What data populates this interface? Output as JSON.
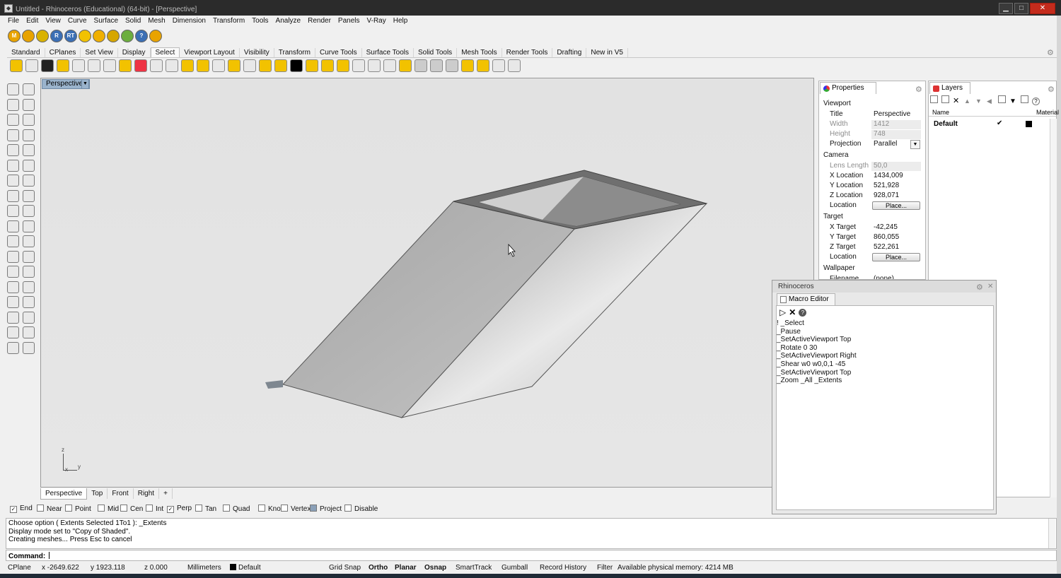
{
  "title_bar": {
    "title": "Untitled - Rhinoceros (Educational) (64-bit) - [Perspective]",
    "minimize": "▁",
    "maximize": "□",
    "close": "✕"
  },
  "menu": [
    "File",
    "Edit",
    "View",
    "Curve",
    "Surface",
    "Solid",
    "Mesh",
    "Dimension",
    "Transform",
    "Tools",
    "Analyze",
    "Render",
    "Panels",
    "V-Ray",
    "Help"
  ],
  "std_toolbar_icons": [
    {
      "name": "m-icon",
      "letter": "M",
      "color": "#e8a300"
    },
    {
      "name": "tag-icon",
      "letter": "",
      "color": "#e8a300"
    },
    {
      "name": "tag2-icon",
      "letter": "",
      "color": "#d9b200"
    },
    {
      "name": "r-icon",
      "letter": "R",
      "color": "#3b6fb5"
    },
    {
      "name": "rt-icon",
      "letter": "RT",
      "color": "#3b6fb5"
    },
    {
      "name": "light-icon",
      "letter": "",
      "color": "#f2c200"
    },
    {
      "name": "sun-icon",
      "letter": "",
      "color": "#f0b000"
    },
    {
      "name": "lamp-icon",
      "letter": "",
      "color": "#d6a600"
    },
    {
      "name": "environment-icon",
      "letter": "",
      "color": "#6cae3e"
    },
    {
      "name": "help-icon",
      "letter": "?",
      "color": "#3b6fb5"
    },
    {
      "name": "settings-icon",
      "letter": "",
      "color": "#e8a300"
    }
  ],
  "toolbar_tabs": [
    "Standard",
    "CPlanes",
    "Set View",
    "Display",
    "Select",
    "Viewport Layout",
    "Visibility",
    "Transform",
    "Curve Tools",
    "Surface Tools",
    "Solid Tools",
    "Mesh Tools",
    "Render Tools",
    "Drafting",
    "New in V5"
  ],
  "active_toolbar_tab": "Select",
  "viewport": {
    "label": "Perspective",
    "tabs": [
      "Perspective",
      "Top",
      "Front",
      "Right",
      "+"
    ],
    "active_tab": "Perspective",
    "axis": {
      "z": "z",
      "x": "x",
      "y": "y"
    }
  },
  "properties": {
    "tab": "Properties",
    "section_viewport": "Viewport",
    "section_camera": "Camera",
    "section_target": "Target",
    "section_wallpaper": "Wallpaper",
    "rows": {
      "title": {
        "label": "Title",
        "value": "Perspective"
      },
      "width": {
        "label": "Width",
        "value": "1412"
      },
      "height": {
        "label": "Height",
        "value": "748"
      },
      "projection": {
        "label": "Projection",
        "value": "Parallel"
      },
      "lens": {
        "label": "Lens Length",
        "value": "50,0"
      },
      "xloc": {
        "label": "X Location",
        "value": "1434,009"
      },
      "yloc": {
        "label": "Y Location",
        "value": "521,928"
      },
      "zloc": {
        "label": "Z Location",
        "value": "928,071"
      },
      "cam_location": {
        "label": "Location",
        "button": "Place..."
      },
      "xtarget": {
        "label": "X Target",
        "value": "-42,245"
      },
      "ytarget": {
        "label": "Y Target",
        "value": "860,055"
      },
      "ztarget": {
        "label": "Z Target",
        "value": "522,261"
      },
      "target_location": {
        "label": "Location",
        "button": "Place..."
      },
      "filename": {
        "label": "Filename",
        "value": "(none)"
      }
    }
  },
  "layers": {
    "tab": "Layers",
    "col_name": "Name",
    "col_material": "Material",
    "row": {
      "name": "Default",
      "check": "✔"
    }
  },
  "macro": {
    "window_title": "Rhinoceros",
    "tab": "Macro Editor",
    "lines": [
      "! _Select",
      "_Pause",
      "_SetActiveViewport Top",
      "_Rotate 0 30",
      "_SetActiveViewport Right",
      "_Shear w0 w0,0,1 -45",
      "_SetActiveViewport Top",
      "_Zoom _All _Extents"
    ]
  },
  "osnap": [
    {
      "label": "End",
      "checked": true
    },
    {
      "label": "Near",
      "checked": false
    },
    {
      "label": "Point",
      "checked": false
    },
    {
      "label": "Mid",
      "checked": false
    },
    {
      "label": "Cen",
      "checked": false
    },
    {
      "label": "Int",
      "checked": false
    },
    {
      "label": "Perp",
      "checked": true
    },
    {
      "label": "Tan",
      "checked": false
    },
    {
      "label": "Quad",
      "checked": false
    },
    {
      "label": "Knot",
      "checked": false
    },
    {
      "label": "Vertex",
      "checked": false
    },
    {
      "label": "Project",
      "checked": false
    },
    {
      "label": "Disable",
      "checked": false
    }
  ],
  "command": {
    "history": [
      "Choose option ( Extents  Selected  1To1 ): _Extents",
      "Display mode set to \"Copy of Shaded\".",
      "Creating meshes... Press Esc to cancel"
    ],
    "prompt": "Command:"
  },
  "status": {
    "cplane": "CPlane",
    "x": "x -2649.622",
    "y": "y 1923.118",
    "z": "z 0.000",
    "units": "Millimeters",
    "layer": "Default",
    "grid_snap": "Grid Snap",
    "ortho": "Ortho",
    "planar": "Planar",
    "osnap": "Osnap",
    "smarttrack": "SmartTrack",
    "gumball": "Gumball",
    "record_history": "Record History",
    "filter": "Filter",
    "memory": "Available physical memory: 4214 MB"
  }
}
